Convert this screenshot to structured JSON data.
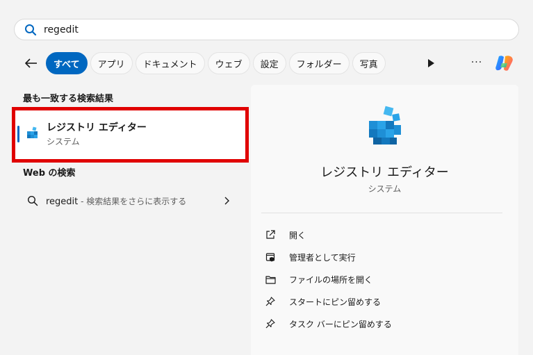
{
  "search": {
    "value": "regedit"
  },
  "filters": {
    "tabs": [
      {
        "label": "すべて",
        "active": true
      },
      {
        "label": "アプリ",
        "active": false
      },
      {
        "label": "ドキュメント",
        "active": false
      },
      {
        "label": "ウェブ",
        "active": false
      },
      {
        "label": "設定",
        "active": false
      },
      {
        "label": "フォルダー",
        "active": false
      },
      {
        "label": "写真",
        "active": false
      }
    ],
    "more_label": "···"
  },
  "best_match": {
    "heading": "最も一致する検索結果",
    "item": {
      "name": "レジストリ エディター",
      "type": "システム",
      "icon": "registry-editor-icon"
    }
  },
  "web": {
    "heading": "Web の検索",
    "item": {
      "query": "regedit",
      "suffix": " - 検索結果をさらに表示する"
    }
  },
  "detail": {
    "title": "レジストリ エディター",
    "subtitle": "システム",
    "actions": [
      {
        "label": "開く",
        "icon": "open-external-icon"
      },
      {
        "label": "管理者として実行",
        "icon": "shield-run-icon"
      },
      {
        "label": "ファイルの場所を開く",
        "icon": "folder-icon"
      },
      {
        "label": "スタートにピン留めする",
        "icon": "pin-icon"
      },
      {
        "label": "タスク バーにピン留めする",
        "icon": "pin-icon"
      }
    ]
  },
  "colors": {
    "accent": "#0067c0",
    "highlight": "#e00000",
    "background": "#f3f3f3"
  }
}
